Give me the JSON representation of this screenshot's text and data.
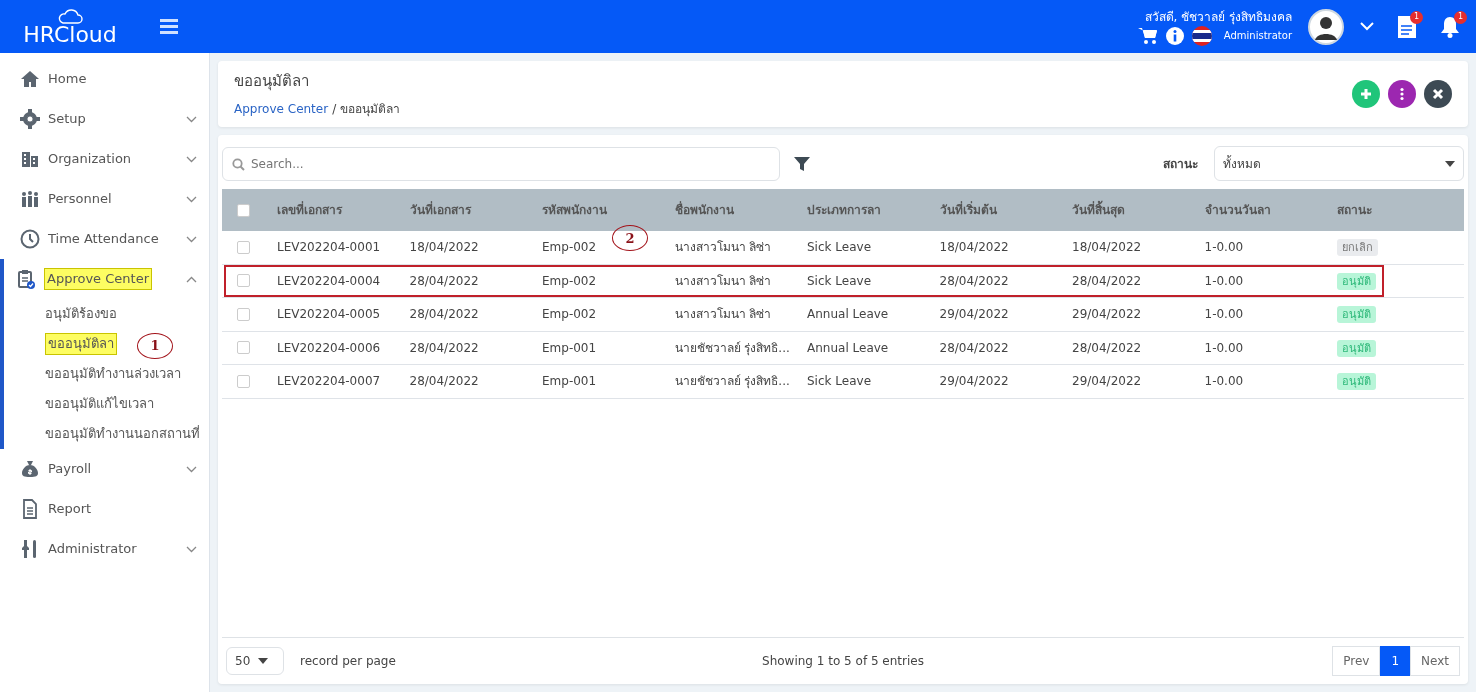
{
  "topbar": {
    "logo": "HRCloud",
    "greeting": "สวัสดี, ชัชวาลย์ รุ่งสิทธิมงคล",
    "role": "Administrator",
    "document_badge": "1",
    "bell_badge": "1"
  },
  "sidebar": {
    "items": [
      {
        "label": "Home",
        "has_children": false,
        "expanded": false,
        "highlighted": false
      },
      {
        "label": "Setup",
        "has_children": true,
        "expanded": false,
        "highlighted": false
      },
      {
        "label": "Organization",
        "has_children": true,
        "expanded": false,
        "highlighted": false
      },
      {
        "label": "Personnel",
        "has_children": true,
        "expanded": false,
        "highlighted": false
      },
      {
        "label": "Time Attendance",
        "has_children": true,
        "expanded": false,
        "highlighted": false
      },
      {
        "label": "Approve Center",
        "has_children": true,
        "expanded": true,
        "highlighted": true,
        "children": [
          {
            "label": "อนุมัติร้องขอ",
            "highlighted": false
          },
          {
            "label": "ขออนุมัติลา",
            "highlighted": true,
            "callout": "1"
          },
          {
            "label": "ขออนุมัติทำงานล่วงเวลา",
            "highlighted": false
          },
          {
            "label": "ขออนุมัติแก้ไขเวลา",
            "highlighted": false
          },
          {
            "label": "ขออนุมัติทำงานนอกสถานที่",
            "highlighted": false
          }
        ]
      },
      {
        "label": "Payroll",
        "has_children": true,
        "expanded": false,
        "highlighted": false
      },
      {
        "label": "Report",
        "has_children": false,
        "expanded": false,
        "highlighted": false
      },
      {
        "label": "Administrator",
        "has_children": true,
        "expanded": false,
        "highlighted": false
      }
    ]
  },
  "page_header": {
    "title": "ขออนุมัติลา",
    "breadcrumb_separator": "/",
    "breadcrumb": [
      {
        "label": "Approve Center",
        "link": true
      },
      {
        "label": "ขออนุมัติลา",
        "link": false
      }
    ]
  },
  "filters": {
    "search_placeholder": "Search...",
    "status_label": "สถานะ",
    "status_value": "ทั้งหมด"
  },
  "table": {
    "select_all_checked": false,
    "columns": [
      "เลขที่เอกสาร",
      "วันที่เอกสาร",
      "รหัสพนักงาน",
      "ชื่อพนักงาน",
      "ประเภทการลา",
      "วันที่เริ่มต้น",
      "วันที่สิ้นสุด",
      "จำนวนวันลา",
      "สถานะ"
    ],
    "rows": [
      {
        "checked": false,
        "outlined": false,
        "callout": "2",
        "cells": [
          "LEV202204-0001",
          "18/04/2022",
          "Emp-002",
          "นางสาวโมนา ลิซ่า",
          "Sick Leave",
          "18/04/2022",
          "18/04/2022",
          "1-0.00"
        ],
        "status": "ยกเลิก",
        "kind": "cancelled"
      },
      {
        "checked": false,
        "outlined": true,
        "cells": [
          "LEV202204-0004",
          "28/04/2022",
          "Emp-002",
          "นางสาวโมนา ลิซ่า",
          "Sick Leave",
          "28/04/2022",
          "28/04/2022",
          "1-0.00"
        ],
        "status": "อนุมัติ",
        "kind": "approved"
      },
      {
        "checked": false,
        "outlined": false,
        "cells": [
          "LEV202204-0005",
          "28/04/2022",
          "Emp-002",
          "นางสาวโมนา ลิซ่า",
          "Annual Leave",
          "29/04/2022",
          "29/04/2022",
          "1-0.00"
        ],
        "status": "อนุมัติ",
        "kind": "approved"
      },
      {
        "checked": false,
        "outlined": false,
        "cells": [
          "LEV202204-0006",
          "28/04/2022",
          "Emp-001",
          "นายชัชวาลย์ รุ่งสิทธิ...",
          "Annual Leave",
          "28/04/2022",
          "28/04/2022",
          "1-0.00"
        ],
        "status": "อนุมัติ",
        "kind": "approved"
      },
      {
        "checked": false,
        "outlined": false,
        "cells": [
          "LEV202204-0007",
          "28/04/2022",
          "Emp-001",
          "นายชัชวาลย์ รุ่งสิทธิ...",
          "Sick Leave",
          "29/04/2022",
          "29/04/2022",
          "1-0.00"
        ],
        "status": "อนุมัติ",
        "kind": "approved"
      }
    ]
  },
  "footer": {
    "page_size": "50",
    "page_size_label": "record per page",
    "summary": "Showing 1 to 5 of 5 entries",
    "pages": [
      {
        "label": "Prev",
        "selected": false
      },
      {
        "label": "1",
        "selected": true
      },
      {
        "label": "Next",
        "selected": false
      }
    ]
  }
}
